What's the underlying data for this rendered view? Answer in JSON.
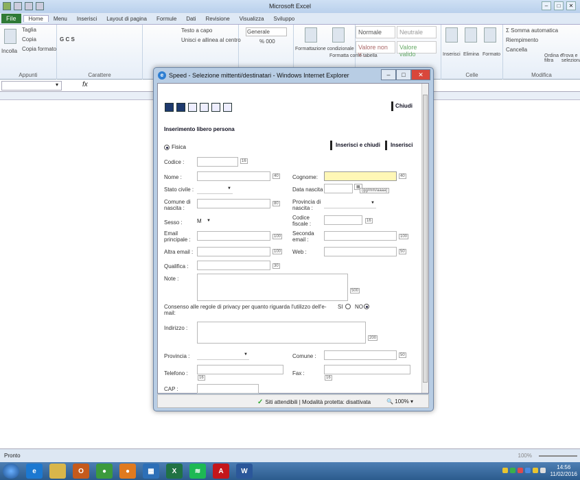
{
  "excel": {
    "title": "Microsoft Excel",
    "tabs": [
      "File",
      "Home",
      "Menu",
      "Inserisci",
      "Layout di pagina",
      "Formule",
      "Dati",
      "Revisione",
      "Visualizza",
      "Sviluppo"
    ],
    "ribbon": {
      "taglia": "Taglia",
      "copia": "Copia",
      "incolla": "Incolla",
      "copia_formato": "Copia formato",
      "appunti": "Appunti",
      "carattere": "Carattere",
      "gcs": "G C S",
      "testo_capo": "Testo a capo",
      "unisci": "Unisci e allinea al centro",
      "generale": "Generale",
      "perc": "% 000",
      "formattazione": "Formattazione condizionale",
      "formatta": "Formatta come tabella",
      "normale": "Normale",
      "neutrale": "Neutrale",
      "valore_non": "Valore non v...",
      "valore_valido": "Valore valido",
      "inserisci": "Inserisci",
      "elimina": "Elimina",
      "formato": "Formato",
      "celle": "Celle",
      "somma": "Σ Somma automatica",
      "riempimento": "Riempimento",
      "cancella": "Cancella",
      "ordina": "Ordina e filtra",
      "trova": "Trova e seleziona",
      "modifica": "Modifica"
    },
    "fx": "fx",
    "status_left": "Pronto",
    "zoom": "100%"
  },
  "ie": {
    "title": "Speed - Selezione mittenti/destinatari - Windows Internet Explorer",
    "status_zone": "Siti attendibili | Modalità protetta: disattivata",
    "zoom": "100%"
  },
  "form": {
    "chiudi": "Chiudi",
    "heading": "Inserimento libero persona",
    "fisica": "Fisica",
    "btn_inserisci_chiudi": "Inserisci e chiudi",
    "btn_inserisci": "Inserisci",
    "codice": "Codice :",
    "codice_max": "16",
    "nome": "Nome :",
    "nome_max": "40",
    "cognome": "Cognome:",
    "cognome_max": "40",
    "stato_civile": "Stato civile :",
    "data_nascita": "Data nascita :",
    "date_fmt": "(gg/mm/aaaa)",
    "comune_nascita": "Comune di nascita :",
    "comune_nascita_max": "80",
    "provincia_nascita": "Provincia di nascita :",
    "sesso": "Sesso :",
    "sesso_val": "M",
    "codice_fiscale": "Codice fiscale :",
    "cf_max": "16",
    "email": "Email principale :",
    "email_max": "100",
    "seconda_email": "Seconda email :",
    "seconda_max": "100",
    "altra_email": "Altra email :",
    "altra_max": "100",
    "web": "Web :",
    "web_max": "50",
    "qualifica": "Qualifica :",
    "qualifica_max": "30",
    "note": "Note :",
    "note_max": "500",
    "privacy": "Consenso alle regole di privacy per quanto riguarda l'utilizzo dell'e-mail:",
    "si": "SI",
    "no": "NO",
    "indirizzo": "Indirizzo :",
    "indirizzo_max": "200",
    "provincia": "Provincia :",
    "comune": "Comune :",
    "comune_max": "50",
    "telefono": "Telefono :",
    "tel_max": "16",
    "fax": "Fax :",
    "fax_max": "16",
    "cap": "CAP :"
  },
  "taskbar": {
    "time": "14:56",
    "date": "11/02/2016"
  }
}
